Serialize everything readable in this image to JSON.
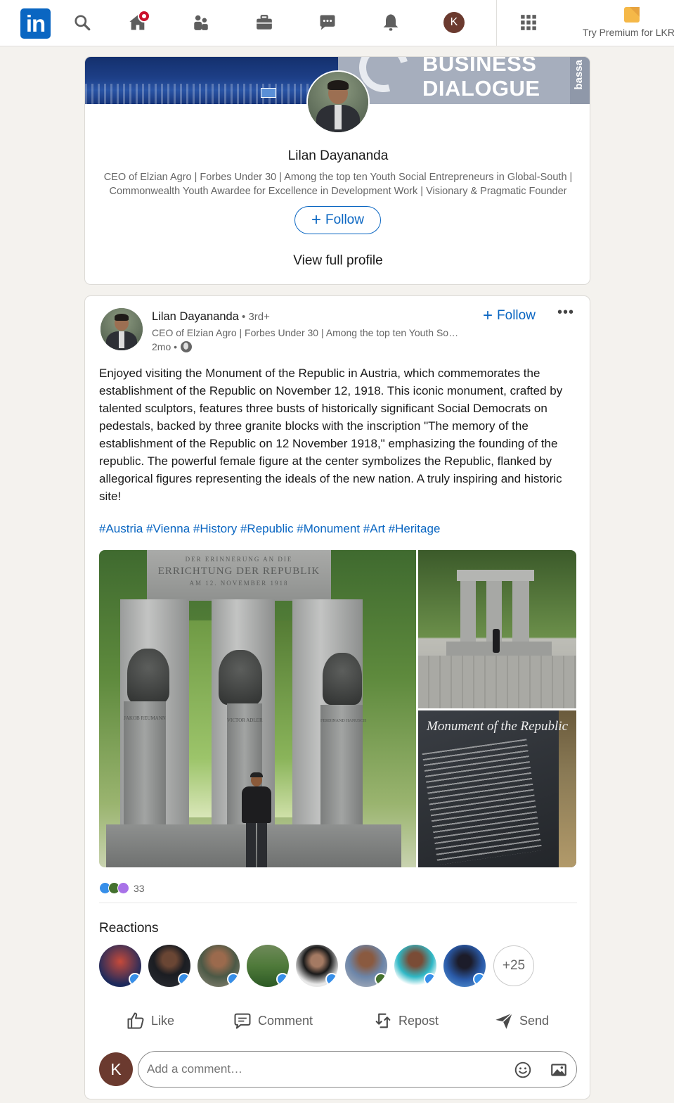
{
  "nav": {
    "logo_text": "in",
    "icons": [
      "search-icon",
      "home-icon",
      "my-network-icon",
      "jobs-icon",
      "messaging-icon",
      "notifications-icon",
      "me-avatar",
      "apps-grid-icon"
    ],
    "me_initial": "K",
    "premium_text": "Try Premium for LKR"
  },
  "profile_card": {
    "banner_text_line1": "BUSINESS",
    "banner_text_line2": "DIALOGUE",
    "banner_side_text": "bassa",
    "name": "Lilan Dayananda",
    "headline": "CEO of Elzian Agro | Forbes Under 30 | Among the top ten Youth Social Entrepreneurs in Global-South | Commonwealth Youth Awardee for Excellence in Development Work | Visionary & Pragmatic Founder",
    "follow_label": "Follow",
    "view_profile_label": "View full profile"
  },
  "post": {
    "author": "Lilan Dayananda",
    "degree": " • 3rd+",
    "headline": "CEO of Elzian Agro | Forbes Under 30 | Among the top ten Youth So…",
    "time": "2mo •",
    "follow_label": "Follow",
    "more_label": "•••",
    "text": "Enjoyed visiting the Monument of the Republic in Austria, which commemorates the establishment of the Republic on November 12, 1918. This iconic monument, crafted by talented sculptors, features three busts of historically significant Social Democrats on pedestals, backed by three granite blocks with the inscription \"The memory of the establishment of the Republic on 12 November 1918,\" emphasizing the founding of the republic. The powerful female figure at the center symbolizes the Republic, flanked by allegorical figures representing the ideals of the new nation. A truly inspiring and historic site!",
    "hashtags": "#Austria #Vienna #History #Republic #Monument #Art #Heritage",
    "photo_inscription_1": "DER ERINNERUNG AN DIE",
    "photo_inscription_2": "ERRICHTUNG DER REPUBLIK",
    "photo_inscription_3": "AM 12. NOVEMBER 1918",
    "photo_names": [
      "JAKOB REUMANN",
      "VICTOR ADLER",
      "FERDINAND HANUSCH"
    ],
    "plaque_title": "Monument of the Republic",
    "reaction_count": "33",
    "reactions_title": "Reactions",
    "more_reactors": "+25",
    "actions": {
      "like": "Like",
      "comment": "Comment",
      "repost": "Repost",
      "send": "Send"
    },
    "comment_initial": "K",
    "comment_placeholder": "Add a comment…"
  },
  "colors": {
    "brand_blue": "#0a66c2",
    "notification_red": "#cb112d",
    "like_blue": "#378fe9",
    "page_bg": "#f4f2ee"
  }
}
